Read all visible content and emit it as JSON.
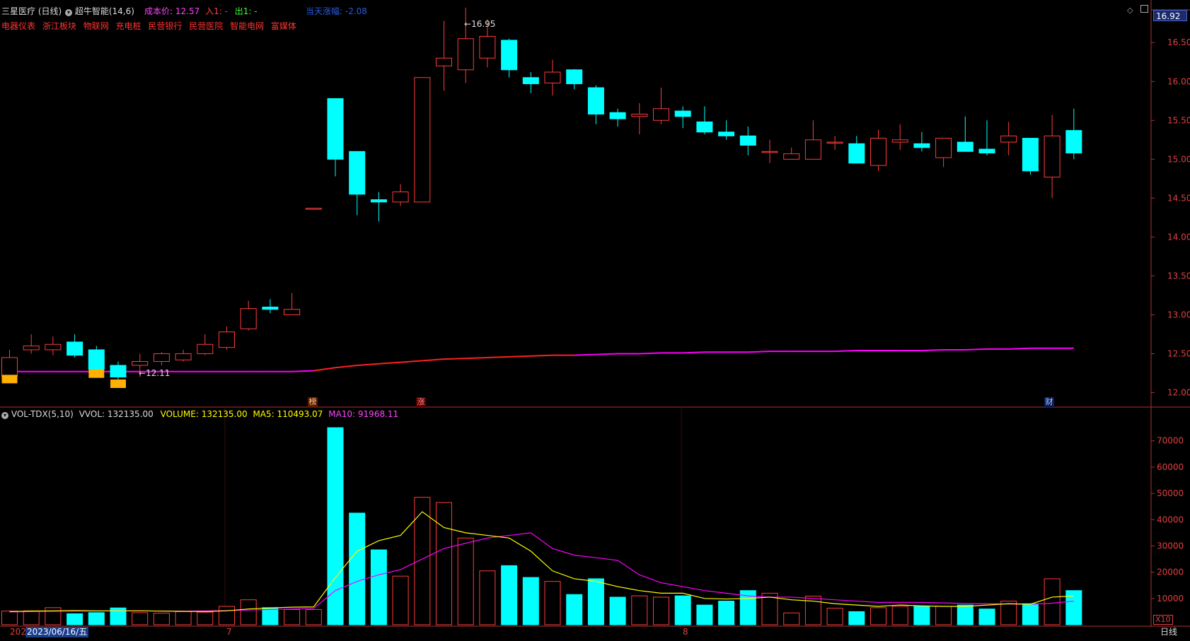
{
  "header": {
    "stock_name": "三星医疗",
    "period": "(日线)",
    "indicator": "超牛智能(14,6)",
    "cost_label": "成本价:",
    "cost_value": "12.57",
    "in_label": "入1:",
    "in_value": "-",
    "out_label": "出1:",
    "out_value": "-",
    "today_label": "当天涨幅:",
    "today_value": "-2.08"
  },
  "sectors": [
    "电器仪表",
    "浙江板块",
    "物联网",
    "充电桩",
    "民营银行",
    "民营医院",
    "智能电网",
    "富媒体"
  ],
  "price_badge": "16.92",
  "volume_header": {
    "title": "VOL-TDX(5,10)",
    "vvol": "VVOL: 132135.00",
    "volume": "VOLUME: 132135.00",
    "ma5": "MA5: 110493.07",
    "ma10": "MA10: 91968.11"
  },
  "annotations": {
    "high": "16.95",
    "low": "12.11"
  },
  "markers": [
    "榜",
    "涨",
    "财"
  ],
  "bottom": {
    "year_prefix": "202",
    "date": "2023/06/16/五",
    "month_7": "7",
    "month_8": "8",
    "period": "日线",
    "vol_unit": "X10"
  },
  "colors": {
    "up": "#ff3b3b",
    "down": "#00ffff",
    "ma5": "#ffff00",
    "ma10": "#ff00ff",
    "cost_line": "#ff00ff",
    "cost_line_active": "#ff2020"
  },
  "chart_data": {
    "type": "candlestick",
    "price_axis": {
      "min": 11.85,
      "max": 16.92,
      "ticks": [
        12.0,
        12.5,
        13.0,
        13.5,
        14.0,
        14.5,
        15.0,
        15.5,
        16.0,
        16.5
      ]
    },
    "volume_axis": {
      "min": 0,
      "max": 78000,
      "ticks": [
        10000,
        20000,
        30000,
        40000,
        50000,
        60000,
        70000
      ]
    },
    "candles": [
      {
        "o": 12.21,
        "c": 12.45,
        "h": 12.55,
        "l": 12.21,
        "v": 5200
      },
      {
        "o": 12.55,
        "c": 12.6,
        "h": 12.75,
        "l": 12.5,
        "v": 5300
      },
      {
        "o": 12.55,
        "c": 12.62,
        "h": 12.72,
        "l": 12.48,
        "v": 6500
      },
      {
        "o": 12.65,
        "c": 12.48,
        "h": 12.75,
        "l": 12.45,
        "v": 4200
      },
      {
        "o": 12.55,
        "c": 12.3,
        "h": 12.6,
        "l": 12.28,
        "v": 4600
      },
      {
        "o": 12.35,
        "c": 12.2,
        "h": 12.4,
        "l": 12.15,
        "v": 6400
      },
      {
        "o": 12.35,
        "c": 12.4,
        "h": 12.5,
        "l": 12.2,
        "v": 4600
      },
      {
        "o": 12.4,
        "c": 12.5,
        "h": 12.52,
        "l": 12.35,
        "v": 4400
      },
      {
        "o": 12.42,
        "c": 12.5,
        "h": 12.55,
        "l": 12.4,
        "v": 5000
      },
      {
        "o": 12.5,
        "c": 12.62,
        "h": 12.75,
        "l": 12.48,
        "v": 4800
      },
      {
        "o": 12.58,
        "c": 12.78,
        "h": 12.85,
        "l": 12.55,
        "v": 7000
      },
      {
        "o": 12.82,
        "c": 13.08,
        "h": 13.18,
        "l": 12.8,
        "v": 9500
      },
      {
        "o": 13.1,
        "c": 13.07,
        "h": 13.2,
        "l": 13.02,
        "v": 6500
      },
      {
        "o": 13.0,
        "c": 13.07,
        "h": 13.28,
        "l": 13.0,
        "v": 5800
      },
      {
        "o": 14.37,
        "c": 14.37,
        "h": 14.37,
        "l": 14.37,
        "v": 5800
      },
      {
        "o": 15.78,
        "c": 15.0,
        "h": 15.78,
        "l": 14.78,
        "v": 75000
      },
      {
        "o": 15.1,
        "c": 14.55,
        "h": 15.1,
        "l": 14.28,
        "v": 42500
      },
      {
        "o": 14.48,
        "c": 14.45,
        "h": 14.58,
        "l": 14.2,
        "v": 28500
      },
      {
        "o": 14.45,
        "c": 14.58,
        "h": 14.68,
        "l": 14.4,
        "v": 18500
      },
      {
        "o": 14.45,
        "c": 16.05,
        "h": 16.05,
        "l": 14.45,
        "v": 48500
      },
      {
        "o": 16.2,
        "c": 16.3,
        "h": 16.78,
        "l": 15.88,
        "v": 46500
      },
      {
        "o": 16.15,
        "c": 16.55,
        "h": 16.95,
        "l": 15.98,
        "v": 33000
      },
      {
        "o": 16.3,
        "c": 16.58,
        "h": 16.8,
        "l": 16.18,
        "v": 20500
      },
      {
        "o": 16.53,
        "c": 16.15,
        "h": 16.55,
        "l": 16.05,
        "v": 22500
      },
      {
        "o": 16.05,
        "c": 15.97,
        "h": 16.12,
        "l": 15.85,
        "v": 18000
      },
      {
        "o": 15.98,
        "c": 16.12,
        "h": 16.28,
        "l": 15.82,
        "v": 16500
      },
      {
        "o": 16.15,
        "c": 15.97,
        "h": 16.16,
        "l": 15.9,
        "v": 11500
      },
      {
        "o": 15.92,
        "c": 15.58,
        "h": 15.95,
        "l": 15.45,
        "v": 17500
      },
      {
        "o": 15.6,
        "c": 15.52,
        "h": 15.65,
        "l": 15.42,
        "v": 10500
      },
      {
        "o": 15.55,
        "c": 15.58,
        "h": 15.72,
        "l": 15.32,
        "v": 11000
      },
      {
        "o": 15.5,
        "c": 15.65,
        "h": 15.92,
        "l": 15.45,
        "v": 10500
      },
      {
        "o": 15.62,
        "c": 15.55,
        "h": 15.68,
        "l": 15.4,
        "v": 11000
      },
      {
        "o": 15.48,
        "c": 15.35,
        "h": 15.68,
        "l": 15.32,
        "v": 7500
      },
      {
        "o": 15.35,
        "c": 15.3,
        "h": 15.5,
        "l": 15.25,
        "v": 9000
      },
      {
        "o": 15.3,
        "c": 15.18,
        "h": 15.42,
        "l": 15.05,
        "v": 13000
      },
      {
        "o": 15.1,
        "c": 15.1,
        "h": 15.25,
        "l": 14.95,
        "v": 12000
      },
      {
        "o": 15.0,
        "c": 15.07,
        "h": 15.15,
        "l": 15.0,
        "v": 4500
      },
      {
        "o": 15.0,
        "c": 15.25,
        "h": 15.5,
        "l": 15.0,
        "v": 10900
      },
      {
        "o": 15.22,
        "c": 15.22,
        "h": 15.3,
        "l": 15.12,
        "v": 6300
      },
      {
        "o": 15.2,
        "c": 14.95,
        "h": 15.3,
        "l": 14.95,
        "v": 5000
      },
      {
        "o": 14.92,
        "c": 15.27,
        "h": 15.38,
        "l": 14.85,
        "v": 6500
      },
      {
        "o": 15.22,
        "c": 15.25,
        "h": 15.45,
        "l": 15.12,
        "v": 7000
      },
      {
        "o": 15.2,
        "c": 15.15,
        "h": 15.35,
        "l": 15.1,
        "v": 7000
      },
      {
        "o": 15.02,
        "c": 15.27,
        "h": 15.27,
        "l": 14.9,
        "v": 7000
      },
      {
        "o": 15.22,
        "c": 15.1,
        "h": 15.55,
        "l": 15.1,
        "v": 7500
      },
      {
        "o": 15.13,
        "c": 15.08,
        "h": 15.5,
        "l": 15.05,
        "v": 6000
      },
      {
        "o": 15.22,
        "c": 15.3,
        "h": 15.48,
        "l": 15.05,
        "v": 9000
      },
      {
        "o": 15.27,
        "c": 14.85,
        "h": 15.27,
        "l": 14.8,
        "v": 8000
      },
      {
        "o": 14.77,
        "c": 15.3,
        "h": 15.57,
        "l": 14.5,
        "v": 17500
      },
      {
        "o": 15.37,
        "c": 15.08,
        "h": 15.65,
        "l": 15.0,
        "v": 13000
      }
    ],
    "cost_line": [
      12.27,
      12.27,
      12.27,
      12.27,
      12.27,
      12.27,
      12.27,
      12.27,
      12.27,
      12.27,
      12.27,
      12.27,
      12.27,
      12.27,
      12.28,
      12.32,
      12.35,
      12.37,
      12.39,
      12.41,
      12.43,
      12.44,
      12.45,
      12.46,
      12.47,
      12.48,
      12.48,
      12.49,
      12.5,
      12.5,
      12.51,
      12.51,
      12.52,
      12.52,
      12.52,
      12.53,
      12.53,
      12.53,
      12.53,
      12.54,
      12.54,
      12.54,
      12.54,
      12.55,
      12.55,
      12.56,
      12.56,
      12.57,
      12.57,
      12.57
    ],
    "ma5": [
      5000,
      5200,
      5300,
      5400,
      5300,
      5300,
      5300,
      5200,
      5100,
      5000,
      5300,
      6000,
      6400,
      6700,
      6800,
      18000,
      28000,
      32000,
      34000,
      43000,
      37000,
      35000,
      34000,
      33000,
      28000,
      20500,
      17500,
      16500,
      14500,
      13000,
      12000,
      12000,
      10000,
      9800,
      10000,
      10500,
      9500,
      9000,
      8000,
      7500,
      7000,
      7500,
      7200,
      7000,
      7000,
      7500,
      8000,
      7800,
      10500,
      11000
    ],
    "ma10": [
      4900,
      5000,
      5100,
      5200,
      5200,
      5300,
      5300,
      5200,
      5200,
      5300,
      5400,
      5600,
      5800,
      6000,
      6200,
      13000,
      16500,
      19000,
      21000,
      25000,
      29000,
      31000,
      33000,
      34000,
      35000,
      29000,
      26500,
      25500,
      24500,
      19000,
      16000,
      14500,
      13000,
      12000,
      11000,
      10500,
      10500,
      10000,
      9500,
      9000,
      8500,
      8500,
      8500,
      8300,
      8100,
      8000,
      7900,
      7800,
      8200,
      9000
    ]
  }
}
